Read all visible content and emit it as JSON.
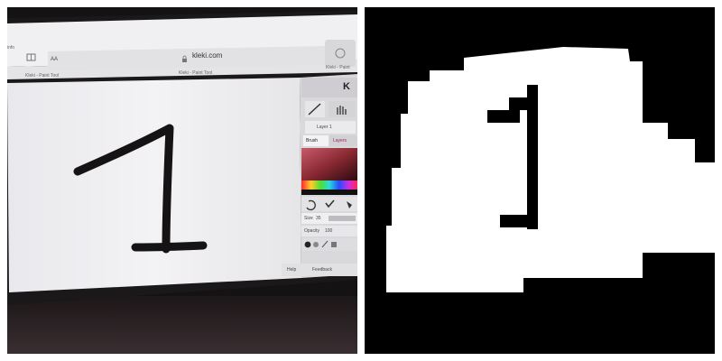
{
  "photo": {
    "browser": {
      "url": "kleki.com",
      "text_size_label": "AA",
      "tab_left": "Kleki - Paint Tool",
      "tab_right": "Kleki - Paint Tool",
      "tab_far_right": "Kleki - Paint",
      "side_label": "info"
    },
    "canvas": {
      "drawn_digit": "1"
    },
    "tool_panel": {
      "layer_label": "Layer 1",
      "tab_brush": "Brush",
      "tab_layers": "Layers",
      "size_label": "Size",
      "size_value": "35",
      "opacity_label": "Opacity",
      "opacity_value": "100",
      "help_label": "Help",
      "feedback_label": "Feedback",
      "brand_glyph": "K"
    },
    "colors": {
      "ink": "#151313",
      "paper": "#f1f0f2",
      "bezel": "#1a1718"
    }
  },
  "mask": {
    "drawn_digit": "1",
    "colors": {
      "background": "#000000",
      "foreground": "#ffffff"
    }
  }
}
